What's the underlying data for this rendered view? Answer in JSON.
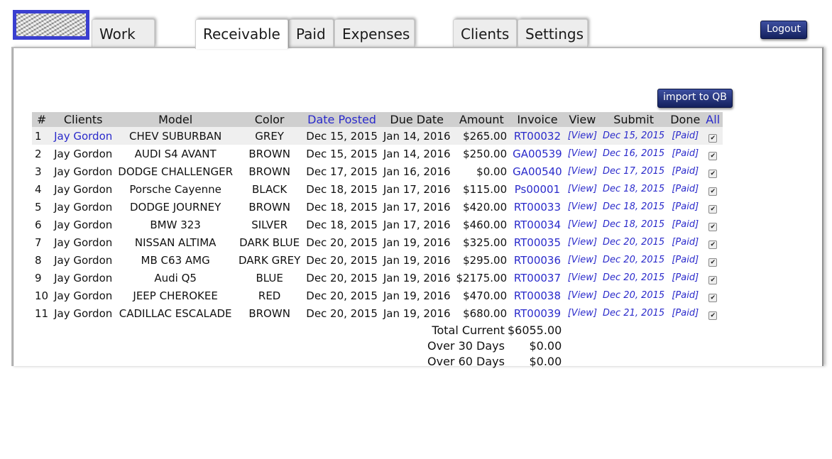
{
  "nav": {
    "tabs": [
      {
        "label": "Work Orders"
      },
      {
        "label": "Receivable"
      },
      {
        "label": "Paid"
      },
      {
        "label": "Expenses"
      },
      {
        "label": "Clients"
      },
      {
        "label": "Settings"
      }
    ],
    "active_tab": "Receivable",
    "logout_label": "Logout"
  },
  "actions": {
    "import_label": "import to QB"
  },
  "table": {
    "headers": [
      "#",
      "Clients",
      "Model",
      "Color",
      "Date Posted",
      "Due Date",
      "Amount",
      "Invoice",
      "View",
      "Submit",
      "Done",
      "All"
    ],
    "rows": [
      {
        "n": "1",
        "client": "Jay Gordon",
        "model": "CHEV SUBURBAN",
        "color": "GREY",
        "posted": "Dec 15, 2015",
        "due": "Jan 14, 2016",
        "amount": "$265.00",
        "invoice": "RT00032",
        "view": "[View]",
        "submit": "Dec 15, 2015",
        "done": "[Paid]"
      },
      {
        "n": "2",
        "client": "Jay Gordon",
        "model": "AUDI S4 AVANT",
        "color": "BROWN",
        "posted": "Dec 15, 2015",
        "due": "Jan 14, 2016",
        "amount": "$250.00",
        "invoice": "GA00539",
        "view": "[View]",
        "submit": "Dec 16, 2015",
        "done": "[Paid]"
      },
      {
        "n": "3",
        "client": "Jay Gordon",
        "model": "DODGE CHALLENGER",
        "color": "BROWN",
        "posted": "Dec 17, 2015",
        "due": "Jan 16, 2016",
        "amount": "$0.00",
        "invoice": "GA00540",
        "view": "[View]",
        "submit": "Dec 17, 2015",
        "done": "[Paid]"
      },
      {
        "n": "4",
        "client": "Jay Gordon",
        "model": "Porsche Cayenne",
        "color": "BLACK",
        "posted": "Dec 18, 2015",
        "due": "Jan 17, 2016",
        "amount": "$115.00",
        "invoice": "Ps00001",
        "view": "[View]",
        "submit": "Dec 18, 2015",
        "done": "[Paid]"
      },
      {
        "n": "5",
        "client": "Jay Gordon",
        "model": "DODGE JOURNEY",
        "color": "BROWN",
        "posted": "Dec 18, 2015",
        "due": "Jan 17, 2016",
        "amount": "$420.00",
        "invoice": "RT00033",
        "view": "[View]",
        "submit": "Dec 18, 2015",
        "done": "[Paid]"
      },
      {
        "n": "6",
        "client": "Jay Gordon",
        "model": "BMW 323",
        "color": "SILVER",
        "posted": "Dec 18, 2015",
        "due": "Jan 17, 2016",
        "amount": "$460.00",
        "invoice": "RT00034",
        "view": "[View]",
        "submit": "Dec 18, 2015",
        "done": "[Paid]"
      },
      {
        "n": "7",
        "client": "Jay Gordon",
        "model": "NISSAN ALTIMA",
        "color": "DARK BLUE",
        "posted": "Dec 20, 2015",
        "due": "Jan 19, 2016",
        "amount": "$325.00",
        "invoice": "RT00035",
        "view": "[View]",
        "submit": "Dec 20, 2015",
        "done": "[Paid]"
      },
      {
        "n": "8",
        "client": "Jay Gordon",
        "model": "MB C63 AMG",
        "color": "DARK GREY",
        "posted": "Dec 20, 2015",
        "due": "Jan 19, 2016",
        "amount": "$295.00",
        "invoice": "RT00036",
        "view": "[View]",
        "submit": "Dec 20, 2015",
        "done": "[Paid]"
      },
      {
        "n": "9",
        "client": "Jay Gordon",
        "model": "Audi Q5",
        "color": "BLUE",
        "posted": "Dec 20, 2015",
        "due": "Jan 19, 2016",
        "amount": "$2175.00",
        "invoice": "RT00037",
        "view": "[View]",
        "submit": "Dec 20, 2015",
        "done": "[Paid]"
      },
      {
        "n": "10",
        "client": "Jay Gordon",
        "model": "JEEP CHEROKEE",
        "color": "RED",
        "posted": "Dec 20, 2015",
        "due": "Jan 19, 2016",
        "amount": "$470.00",
        "invoice": "RT00038",
        "view": "[View]",
        "submit": "Dec 20, 2015",
        "done": "[Paid]"
      },
      {
        "n": "11",
        "client": "Jay Gordon",
        "model": "CADILLAC ESCALADE",
        "color": "BROWN",
        "posted": "Dec 20, 2015",
        "due": "Jan 19, 2016",
        "amount": "$680.00",
        "invoice": "RT00039",
        "view": "[View]",
        "submit": "Dec 21, 2015",
        "done": "[Paid]"
      }
    ]
  },
  "totals": {
    "current_label": "Total Current",
    "current_value": "$6055.00",
    "over30_label": "Over 30 Days",
    "over30_value": "$0.00",
    "over60_label": "Over 60 Days",
    "over60_value": "$0.00"
  },
  "colors": {
    "link": "#2a2acb",
    "button": "#1c2b73",
    "header_bg": "#cfcfcf"
  }
}
